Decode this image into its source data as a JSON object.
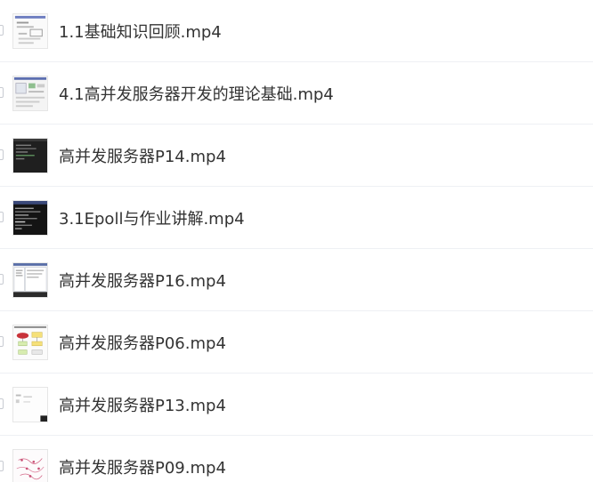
{
  "files": [
    {
      "name": "1.1基础知识回顾.mp4",
      "thumbnail": "diagram-thumbnail"
    },
    {
      "name": "4.1高并发服务器开发的理论基础.mp4",
      "thumbnail": "slide-thumbnail"
    },
    {
      "name": "高并发服务器P14.mp4",
      "thumbnail": "terminal-thumbnail"
    },
    {
      "name": "3.1Epoll与作业讲解.mp4",
      "thumbnail": "terminal-thumbnail"
    },
    {
      "name": "高并发服务器P16.mp4",
      "thumbnail": "window-thumbnail"
    },
    {
      "name": "高并发服务器P06.mp4",
      "thumbnail": "flowchart-thumbnail"
    },
    {
      "name": "高并发服务器P13.mp4",
      "thumbnail": "blank-slide-thumbnail"
    },
    {
      "name": "高并发服务器P09.mp4",
      "thumbnail": "mindmap-thumbnail"
    }
  ]
}
